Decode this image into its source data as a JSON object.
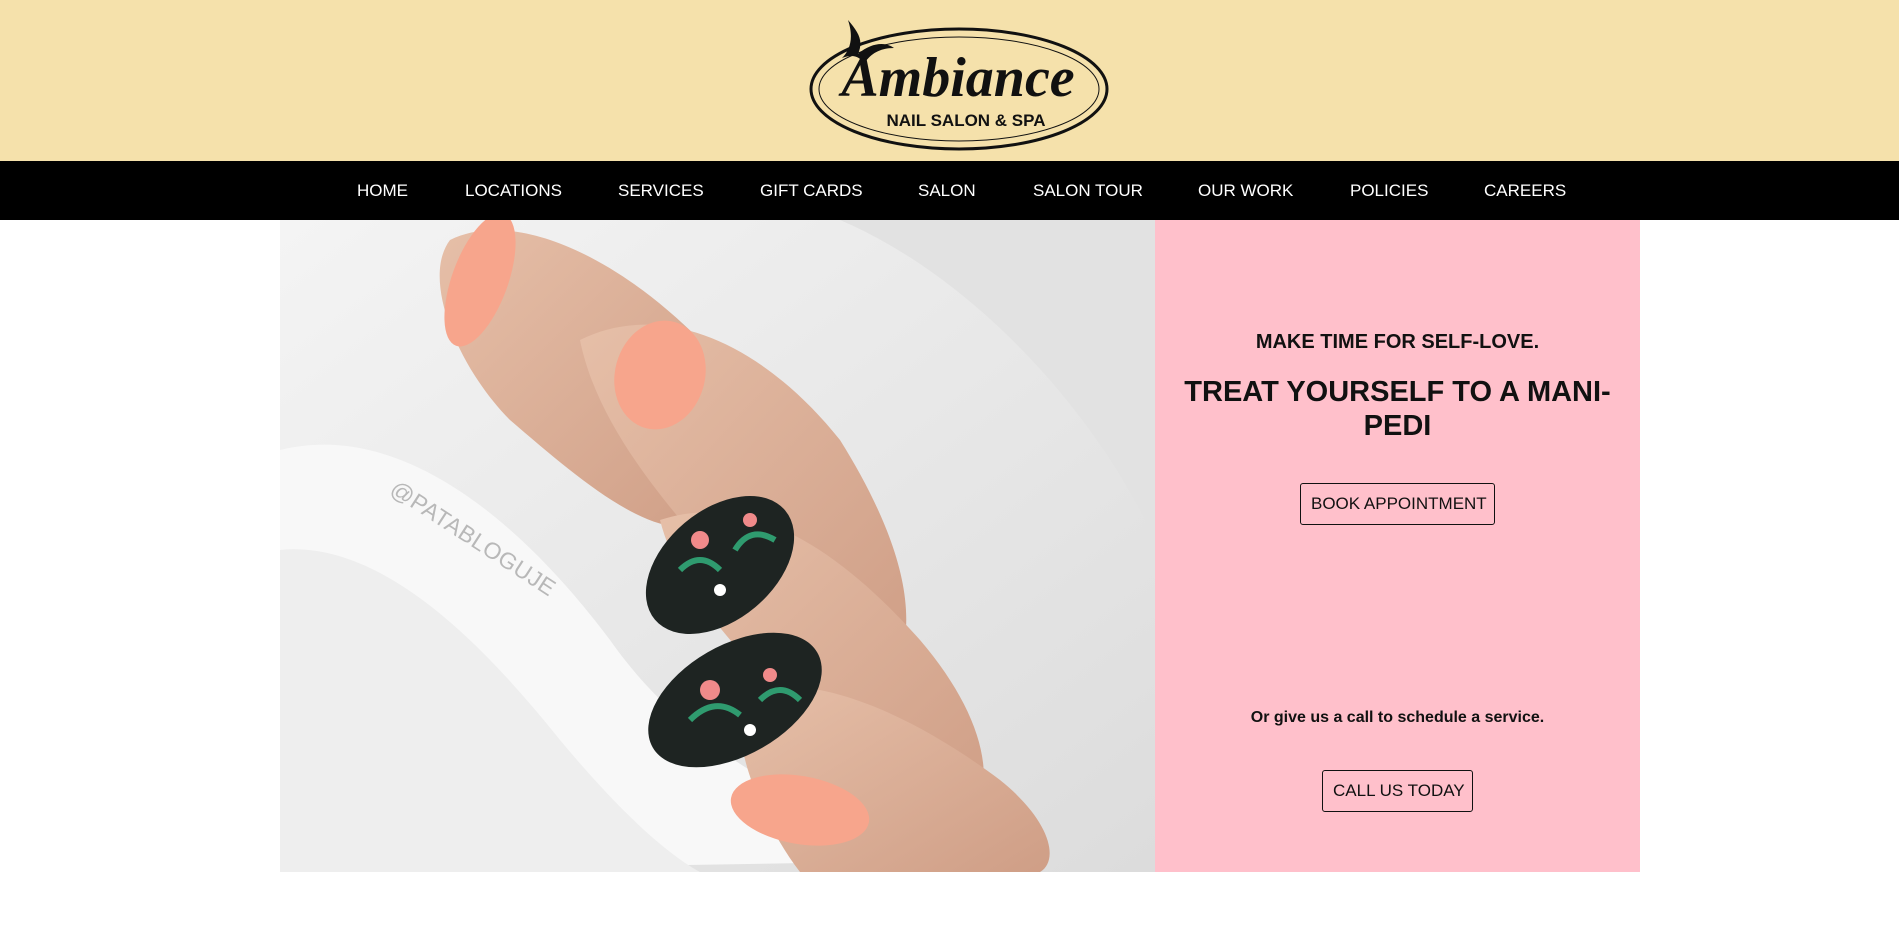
{
  "header": {
    "logo_wordmark": "Ambiance",
    "logo_tagline": "NAIL SALON & SPA"
  },
  "nav": {
    "items": [
      {
        "label": "HOME"
      },
      {
        "label": "LOCATIONS"
      },
      {
        "label": "SERVICES"
      },
      {
        "label": "GIFT CARDS"
      },
      {
        "label": "SALON"
      },
      {
        "label": "SALON TOUR"
      },
      {
        "label": "OUR WORK"
      },
      {
        "label": "POLICIES"
      },
      {
        "label": "CAREERS"
      }
    ]
  },
  "hero": {
    "image_watermark": "@PATABLOGUJE"
  },
  "promo": {
    "eyebrow": "MAKE TIME FOR SELF-LOVE.",
    "headline": "TREAT YOURSELF TO A MANI-PEDI",
    "book_button": "BOOK APPOINTMENT",
    "call_text": "Or give us a call to schedule a service.",
    "call_button": "CALL US TODAY"
  },
  "colors": {
    "header_bg": "#f5e1ab",
    "nav_bg": "#000000",
    "promo_bg": "#ffc0cb",
    "text": "#111111"
  }
}
